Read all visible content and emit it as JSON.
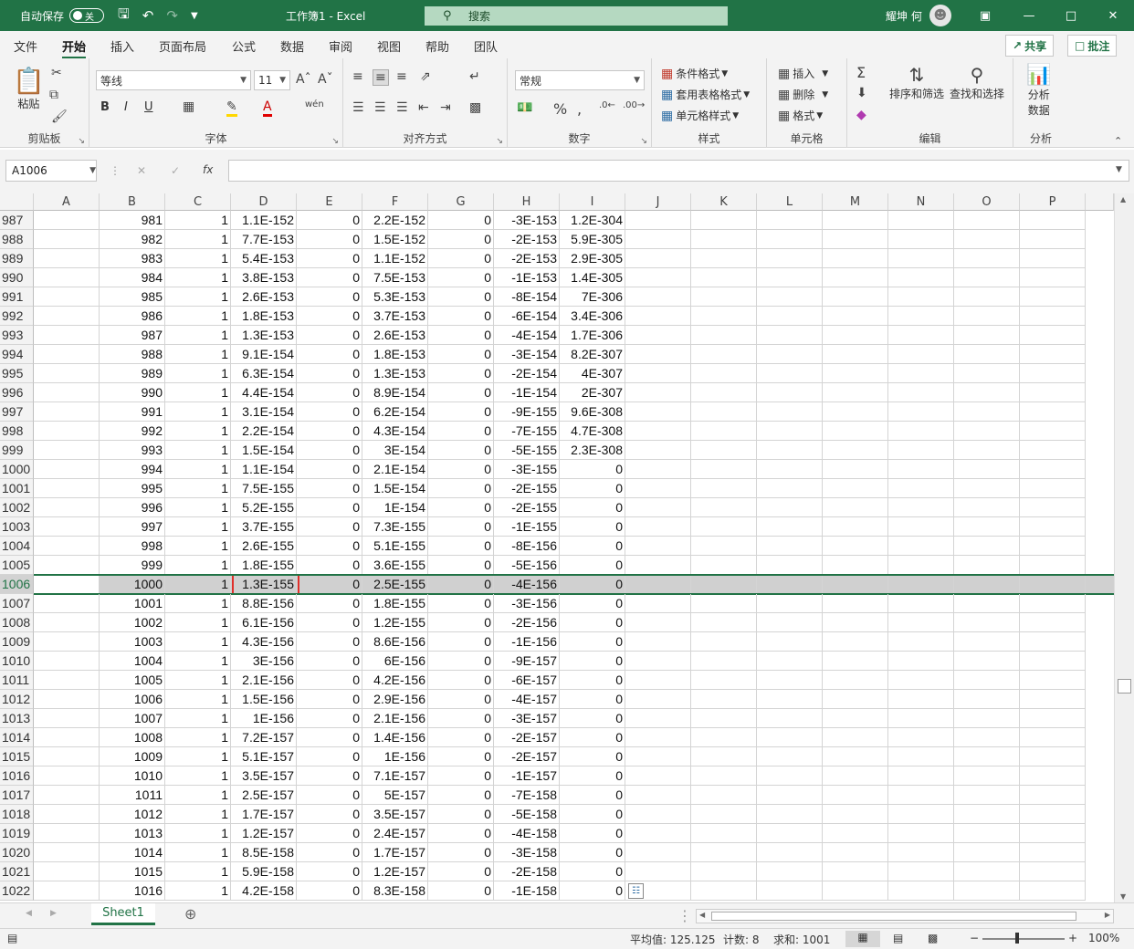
{
  "titlebar": {
    "autosave_label": "自动保存",
    "autosave_state": "关",
    "title": "工作簿1  -  Excel",
    "search_placeholder": "搜索",
    "user_name": "耀坤 何"
  },
  "tabs": [
    "文件",
    "开始",
    "插入",
    "页面布局",
    "公式",
    "数据",
    "审阅",
    "视图",
    "帮助",
    "团队"
  ],
  "active_tab": "开始",
  "share_label": "共享",
  "comment_label": "批注",
  "ribbon": {
    "clipboard": {
      "label": "剪贴板",
      "paste": "粘贴"
    },
    "font": {
      "label": "字体",
      "font_name": "等线",
      "font_size": "11",
      "bold": "B",
      "italic": "I",
      "underline": "U"
    },
    "alignment": {
      "label": "对齐方式"
    },
    "number": {
      "label": "数字",
      "format": "常规"
    },
    "styles": {
      "label": "样式",
      "conditional": "条件格式",
      "table": "套用表格格式",
      "cell": "单元格样式"
    },
    "cells": {
      "label": "单元格",
      "insert": "插入",
      "delete": "删除",
      "format": "格式"
    },
    "editing": {
      "label": "编辑",
      "sort": "排序和筛选",
      "find": "查找和选择"
    },
    "analysis": {
      "label": "分析",
      "analyze_line1": "分析",
      "analyze_line2": "数据"
    }
  },
  "formula_bar": {
    "name_box": "A1006",
    "fx": "fx",
    "value": ""
  },
  "columns": [
    "A",
    "B",
    "C",
    "D",
    "E",
    "F",
    "G",
    "H",
    "I",
    "J",
    "K",
    "L",
    "M",
    "N",
    "O",
    "P"
  ],
  "rows": [
    {
      "n": "987",
      "cells": [
        "",
        "981",
        "1",
        "1.1E-152",
        "0",
        "2.2E-152",
        "0",
        "-3E-153",
        "1.2E-304"
      ]
    },
    {
      "n": "988",
      "cells": [
        "",
        "982",
        "1",
        "7.7E-153",
        "0",
        "1.5E-152",
        "0",
        "-2E-153",
        "5.9E-305"
      ]
    },
    {
      "n": "989",
      "cells": [
        "",
        "983",
        "1",
        "5.4E-153",
        "0",
        "1.1E-152",
        "0",
        "-2E-153",
        "2.9E-305"
      ]
    },
    {
      "n": "990",
      "cells": [
        "",
        "984",
        "1",
        "3.8E-153",
        "0",
        "7.5E-153",
        "0",
        "-1E-153",
        "1.4E-305"
      ]
    },
    {
      "n": "991",
      "cells": [
        "",
        "985",
        "1",
        "2.6E-153",
        "0",
        "5.3E-153",
        "0",
        "-8E-154",
        "7E-306"
      ]
    },
    {
      "n": "992",
      "cells": [
        "",
        "986",
        "1",
        "1.8E-153",
        "0",
        "3.7E-153",
        "0",
        "-6E-154",
        "3.4E-306"
      ]
    },
    {
      "n": "993",
      "cells": [
        "",
        "987",
        "1",
        "1.3E-153",
        "0",
        "2.6E-153",
        "0",
        "-4E-154",
        "1.7E-306"
      ]
    },
    {
      "n": "994",
      "cells": [
        "",
        "988",
        "1",
        "9.1E-154",
        "0",
        "1.8E-153",
        "0",
        "-3E-154",
        "8.2E-307"
      ]
    },
    {
      "n": "995",
      "cells": [
        "",
        "989",
        "1",
        "6.3E-154",
        "0",
        "1.3E-153",
        "0",
        "-2E-154",
        "4E-307"
      ]
    },
    {
      "n": "996",
      "cells": [
        "",
        "990",
        "1",
        "4.4E-154",
        "0",
        "8.9E-154",
        "0",
        "-1E-154",
        "2E-307"
      ]
    },
    {
      "n": "997",
      "cells": [
        "",
        "991",
        "1",
        "3.1E-154",
        "0",
        "6.2E-154",
        "0",
        "-9E-155",
        "9.6E-308"
      ]
    },
    {
      "n": "998",
      "cells": [
        "",
        "992",
        "1",
        "2.2E-154",
        "0",
        "4.3E-154",
        "0",
        "-7E-155",
        "4.7E-308"
      ]
    },
    {
      "n": "999",
      "cells": [
        "",
        "993",
        "1",
        "1.5E-154",
        "0",
        "3E-154",
        "0",
        "-5E-155",
        "2.3E-308"
      ]
    },
    {
      "n": "1000",
      "cells": [
        "",
        "994",
        "1",
        "1.1E-154",
        "0",
        "2.1E-154",
        "0",
        "-3E-155",
        "0"
      ]
    },
    {
      "n": "1001",
      "cells": [
        "",
        "995",
        "1",
        "7.5E-155",
        "0",
        "1.5E-154",
        "0",
        "-2E-155",
        "0"
      ]
    },
    {
      "n": "1002",
      "cells": [
        "",
        "996",
        "1",
        "5.2E-155",
        "0",
        "1E-154",
        "0",
        "-2E-155",
        "0"
      ]
    },
    {
      "n": "1003",
      "cells": [
        "",
        "997",
        "1",
        "3.7E-155",
        "0",
        "7.3E-155",
        "0",
        "-1E-155",
        "0"
      ]
    },
    {
      "n": "1004",
      "cells": [
        "",
        "998",
        "1",
        "2.6E-155",
        "0",
        "5.1E-155",
        "0",
        "-8E-156",
        "0"
      ]
    },
    {
      "n": "1005",
      "cells": [
        "",
        "999",
        "1",
        "1.8E-155",
        "0",
        "3.6E-155",
        "0",
        "-5E-156",
        "0"
      ]
    },
    {
      "n": "1006",
      "cells": [
        "",
        "1000",
        "1",
        "1.3E-155",
        "0",
        "2.5E-155",
        "0",
        "-4E-156",
        "0"
      ]
    },
    {
      "n": "1007",
      "cells": [
        "",
        "1001",
        "1",
        "8.8E-156",
        "0",
        "1.8E-155",
        "0",
        "-3E-156",
        "0"
      ]
    },
    {
      "n": "1008",
      "cells": [
        "",
        "1002",
        "1",
        "6.1E-156",
        "0",
        "1.2E-155",
        "0",
        "-2E-156",
        "0"
      ]
    },
    {
      "n": "1009",
      "cells": [
        "",
        "1003",
        "1",
        "4.3E-156",
        "0",
        "8.6E-156",
        "0",
        "-1E-156",
        "0"
      ]
    },
    {
      "n": "1010",
      "cells": [
        "",
        "1004",
        "1",
        "3E-156",
        "0",
        "6E-156",
        "0",
        "-9E-157",
        "0"
      ]
    },
    {
      "n": "1011",
      "cells": [
        "",
        "1005",
        "1",
        "2.1E-156",
        "0",
        "4.2E-156",
        "0",
        "-6E-157",
        "0"
      ]
    },
    {
      "n": "1012",
      "cells": [
        "",
        "1006",
        "1",
        "1.5E-156",
        "0",
        "2.9E-156",
        "0",
        "-4E-157",
        "0"
      ]
    },
    {
      "n": "1013",
      "cells": [
        "",
        "1007",
        "1",
        "1E-156",
        "0",
        "2.1E-156",
        "0",
        "-3E-157",
        "0"
      ]
    },
    {
      "n": "1014",
      "cells": [
        "",
        "1008",
        "1",
        "7.2E-157",
        "0",
        "1.4E-156",
        "0",
        "-2E-157",
        "0"
      ]
    },
    {
      "n": "1015",
      "cells": [
        "",
        "1009",
        "1",
        "5.1E-157",
        "0",
        "1E-156",
        "0",
        "-2E-157",
        "0"
      ]
    },
    {
      "n": "1016",
      "cells": [
        "",
        "1010",
        "1",
        "3.5E-157",
        "0",
        "7.1E-157",
        "0",
        "-1E-157",
        "0"
      ]
    },
    {
      "n": "1017",
      "cells": [
        "",
        "1011",
        "1",
        "2.5E-157",
        "0",
        "5E-157",
        "0",
        "-7E-158",
        "0"
      ]
    },
    {
      "n": "1018",
      "cells": [
        "",
        "1012",
        "1",
        "1.7E-157",
        "0",
        "3.5E-157",
        "0",
        "-5E-158",
        "0"
      ]
    },
    {
      "n": "1019",
      "cells": [
        "",
        "1013",
        "1",
        "1.2E-157",
        "0",
        "2.4E-157",
        "0",
        "-4E-158",
        "0"
      ]
    },
    {
      "n": "1020",
      "cells": [
        "",
        "1014",
        "1",
        "8.5E-158",
        "0",
        "1.7E-157",
        "0",
        "-3E-158",
        "0"
      ]
    },
    {
      "n": "1021",
      "cells": [
        "",
        "1015",
        "1",
        "5.9E-158",
        "0",
        "1.2E-157",
        "0",
        "-2E-158",
        "0"
      ]
    },
    {
      "n": "1022",
      "cells": [
        "",
        "1016",
        "1",
        "4.2E-158",
        "0",
        "8.3E-158",
        "0",
        "-1E-158",
        "0"
      ]
    }
  ],
  "selected_row": "1006",
  "highlighted_cell": "D1006",
  "sheet_tab": "Sheet1",
  "status": {
    "average": "平均值: 125.125",
    "count": "计数: 8",
    "sum": "求和: 1001",
    "zoom": "100%"
  },
  "colors": {
    "excel_green": "#217346",
    "highlight_red": "#e0302a",
    "selected_row": "#d0d0d0"
  }
}
